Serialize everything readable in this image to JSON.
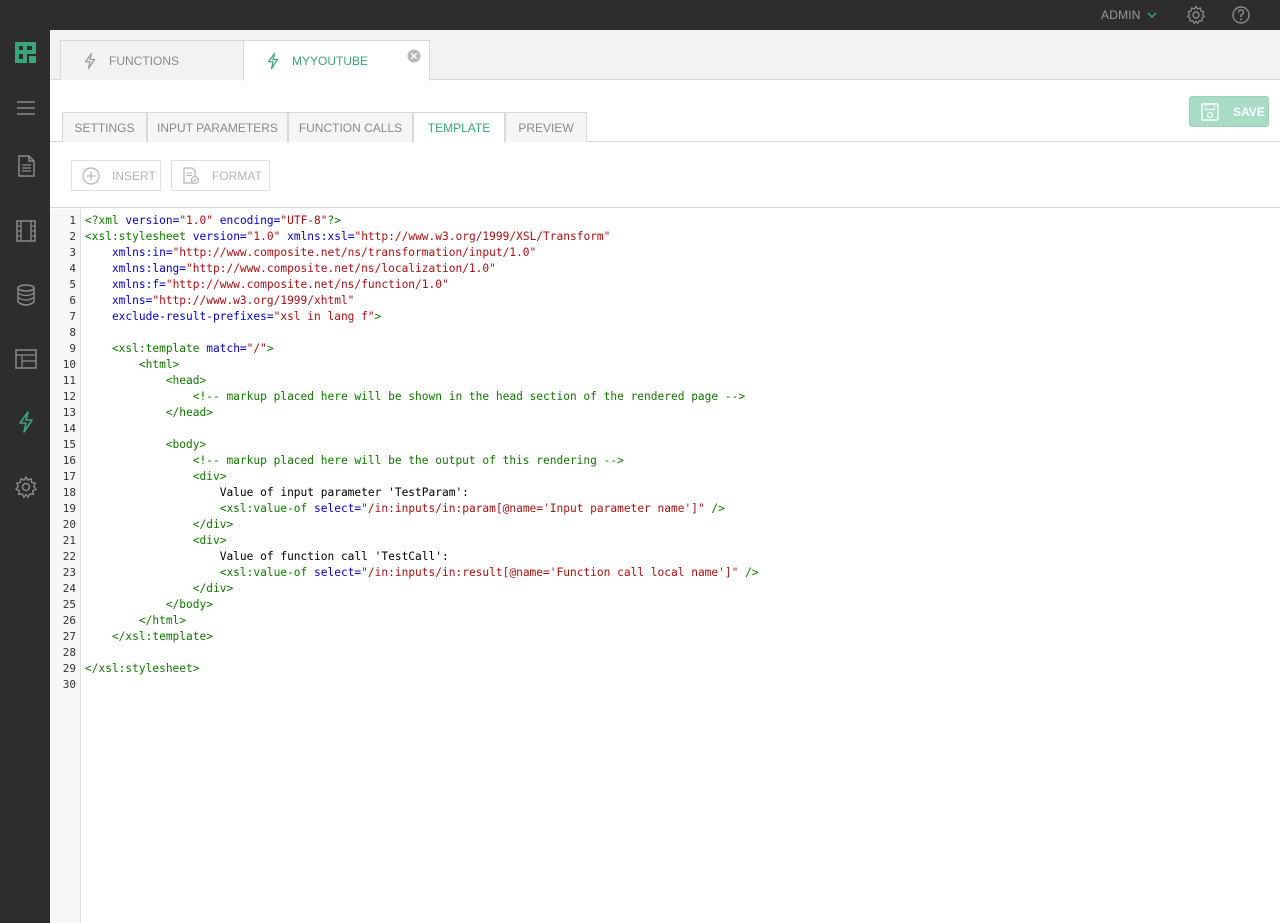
{
  "topbar": {
    "user_label": "ADMIN",
    "icons": [
      "chevron-down-icon",
      "gear-icon",
      "help-icon"
    ]
  },
  "sidebar": {
    "items": [
      {
        "name": "logo-icon"
      },
      {
        "name": "menu-icon"
      },
      {
        "name": "page-icon"
      },
      {
        "name": "media-icon"
      },
      {
        "name": "data-icon"
      },
      {
        "name": "layout-icon"
      },
      {
        "name": "function-icon",
        "active": true
      },
      {
        "name": "settings-icon"
      }
    ],
    "accent": "#3aa57a"
  },
  "doc_tabs": [
    {
      "label": "FUNCTIONS",
      "active": false
    },
    {
      "label": "MYYOUTUBE",
      "active": true
    }
  ],
  "sub_tabs": [
    {
      "label": "SETTINGS"
    },
    {
      "label": "INPUT PARAMETERS"
    },
    {
      "label": "FUNCTION CALLS"
    },
    {
      "label": "TEMPLATE",
      "active": true
    },
    {
      "label": "PREVIEW"
    }
  ],
  "save_label": "SAVE",
  "toolbar": {
    "insert_label": "INSERT",
    "format_label": "FORMAT"
  },
  "editor": {
    "line_numbers": [
      "1",
      "2",
      "3",
      "4",
      "5",
      "6",
      "7",
      "8",
      "9",
      "10",
      "11",
      "12",
      "13",
      "14",
      "15",
      "16",
      "17",
      "18",
      "19",
      "20",
      "21",
      "22",
      "23",
      "24",
      "25",
      "26",
      "27",
      "28",
      "29",
      "30"
    ],
    "lines": [
      [
        {
          "t": "tag",
          "v": "<?xml"
        },
        {
          "t": "attr",
          "v": " version="
        },
        {
          "t": "str",
          "v": "\"1.0\""
        },
        {
          "t": "attr",
          "v": " encoding="
        },
        {
          "t": "str",
          "v": "\"UTF-8\""
        },
        {
          "t": "tag",
          "v": "?>"
        }
      ],
      [
        {
          "t": "tag",
          "v": "<xsl:stylesheet"
        },
        {
          "t": "attr",
          "v": " version="
        },
        {
          "t": "str",
          "v": "\"1.0\""
        },
        {
          "t": "attr",
          "v": " xmlns:xsl="
        },
        {
          "t": "str",
          "v": "\"http://www.w3.org/1999/XSL/Transform\""
        }
      ],
      [
        {
          "t": "attr",
          "v": "    xmlns:in="
        },
        {
          "t": "str",
          "v": "\"http://www.composite.net/ns/transformation/input/1.0\""
        }
      ],
      [
        {
          "t": "attr",
          "v": "    xmlns:lang="
        },
        {
          "t": "str",
          "v": "\"http://www.composite.net/ns/localization/1.0\""
        }
      ],
      [
        {
          "t": "attr",
          "v": "    xmlns:f="
        },
        {
          "t": "str",
          "v": "\"http://www.composite.net/ns/function/1.0\""
        }
      ],
      [
        {
          "t": "attr",
          "v": "    xmlns="
        },
        {
          "t": "str",
          "v": "\"http://www.w3.org/1999/xhtml\""
        }
      ],
      [
        {
          "t": "attr",
          "v": "    exclude-result-prefixes="
        },
        {
          "t": "str",
          "v": "\"xsl in lang f\""
        },
        {
          "t": "tag",
          "v": ">"
        }
      ],
      [],
      [
        {
          "t": "tag",
          "v": "    <xsl:template"
        },
        {
          "t": "attr",
          "v": " match="
        },
        {
          "t": "str",
          "v": "\"/\""
        },
        {
          "t": "tag",
          "v": ">"
        }
      ],
      [
        {
          "t": "tag",
          "v": "        <html>"
        }
      ],
      [
        {
          "t": "tag",
          "v": "            <head>"
        }
      ],
      [
        {
          "t": "com",
          "v": "                <!-- markup placed here will be shown in the head section of the rendered page -->"
        }
      ],
      [
        {
          "t": "tag",
          "v": "            </head>"
        }
      ],
      [],
      [
        {
          "t": "tag",
          "v": "            <body>"
        }
      ],
      [
        {
          "t": "com",
          "v": "                <!-- markup placed here will be the output of this rendering -->"
        }
      ],
      [
        {
          "t": "tag",
          "v": "                <div>"
        }
      ],
      [
        {
          "t": "txt",
          "v": "                    Value of input parameter 'TestParam':"
        }
      ],
      [
        {
          "t": "tag",
          "v": "                    <xsl:value-of"
        },
        {
          "t": "attr",
          "v": " select="
        },
        {
          "t": "str",
          "v": "\"/in:inputs/in:param[@name='Input parameter name']\""
        },
        {
          "t": "tag",
          "v": " />"
        }
      ],
      [
        {
          "t": "tag",
          "v": "                </div>"
        }
      ],
      [
        {
          "t": "tag",
          "v": "                <div>"
        }
      ],
      [
        {
          "t": "txt",
          "v": "                    Value of function call 'TestCall':"
        }
      ],
      [
        {
          "t": "tag",
          "v": "                    <xsl:value-of"
        },
        {
          "t": "attr",
          "v": " select="
        },
        {
          "t": "str",
          "v": "\"/in:inputs/in:result[@name='Function call local name']\""
        },
        {
          "t": "tag",
          "v": " />"
        }
      ],
      [
        {
          "t": "tag",
          "v": "                </div>"
        }
      ],
      [
        {
          "t": "tag",
          "v": "            </body>"
        }
      ],
      [
        {
          "t": "tag",
          "v": "        </html>"
        }
      ],
      [
        {
          "t": "tag",
          "v": "    </xsl:template>"
        }
      ],
      [],
      [
        {
          "t": "tag",
          "v": "</xsl:stylesheet>"
        }
      ],
      []
    ]
  }
}
